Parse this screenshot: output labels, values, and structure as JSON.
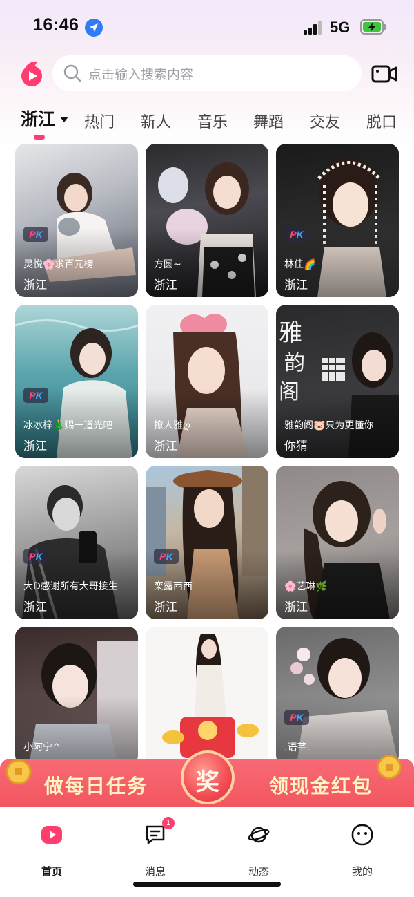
{
  "status_bar": {
    "time": "16:46",
    "network": "5G"
  },
  "header": {
    "search_placeholder": "点击输入搜索内容"
  },
  "tabs": [
    {
      "label": "浙江",
      "active": true
    },
    {
      "label": "热门"
    },
    {
      "label": "新人"
    },
    {
      "label": "音乐"
    },
    {
      "label": "舞蹈"
    },
    {
      "label": "交友"
    },
    {
      "label": "脱口"
    }
  ],
  "cards": [
    {
      "name": "灵悦🌸求百元榜",
      "region": "浙江",
      "pk": true
    },
    {
      "name": "方圆~",
      "region": "浙江",
      "pk": false
    },
    {
      "name": "林佳🌈",
      "region": "浙江",
      "pk": true
    },
    {
      "name": "冰冰梓🎄赐一道光吧",
      "region": "浙江",
      "pk": true
    },
    {
      "name": "撩人雅ღ",
      "region": "浙江",
      "pk": false
    },
    {
      "name": "雅韵阁🐷只为更懂你",
      "region": "你猜",
      "pk": false
    },
    {
      "name": "大D感谢所有大哥接生",
      "region": "浙江",
      "pk": true
    },
    {
      "name": "栾露西西",
      "region": "浙江",
      "pk": true
    },
    {
      "name": "🌸艺琳🌿",
      "region": "浙江",
      "pk": false
    },
    {
      "name": "小阿宁^",
      "region": "",
      "pk": false
    },
    {
      "name": "",
      "region": "",
      "pk": false
    },
    {
      "name": ".语芊.",
      "region": "",
      "pk": true
    }
  ],
  "card_art": {
    "pk_p": "P",
    "pk_k": "K",
    "poster_text": [
      "雅",
      "韵",
      "阁"
    ]
  },
  "promo": {
    "left": "做每日任务",
    "center": "奖",
    "right": "领现金红包"
  },
  "bottom_nav": [
    {
      "label": "首页",
      "icon": "play-icon",
      "active": true
    },
    {
      "label": "消息",
      "icon": "message-icon",
      "badge": "1"
    },
    {
      "label": "动态",
      "icon": "planet-icon"
    },
    {
      "label": "我的",
      "icon": "face-icon"
    }
  ],
  "colors": {
    "accent": "#ff3d75",
    "promo": "#f25a64"
  }
}
